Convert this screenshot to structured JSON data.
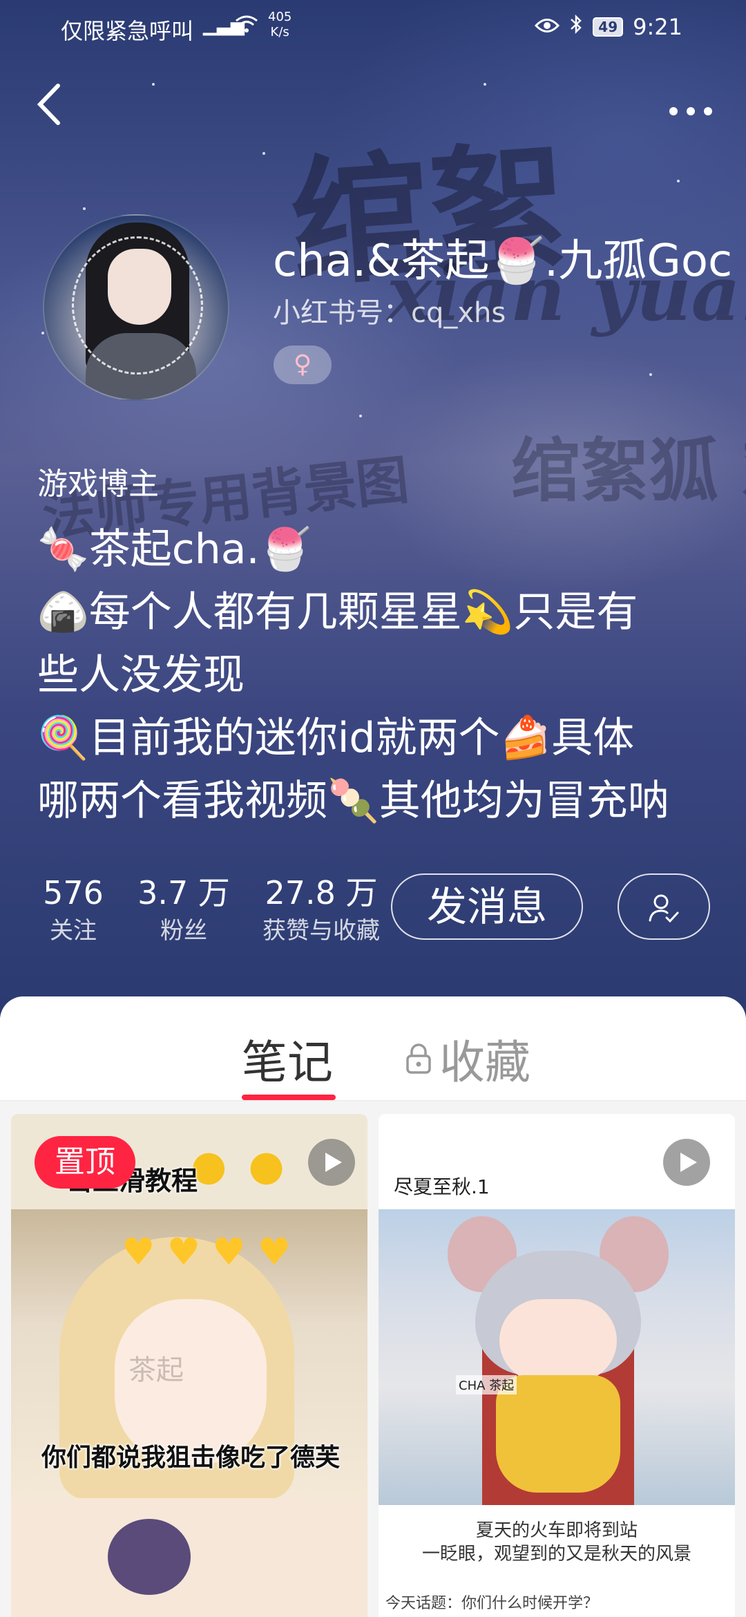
{
  "status_bar": {
    "carrier": "仅限紧急呼叫",
    "speed_value": "405",
    "speed_unit": "K/s",
    "battery": "49",
    "time": "9:21"
  },
  "profile": {
    "username": "cha.&茶起🍧.九孤Goc",
    "id_text": "小红书号：cq_xhs",
    "gender_symbol": "♀",
    "tag": "游戏博主",
    "bio_lines": [
      "🍬茶起cha.🍧",
      "🍙每个人都有几颗星星💫只是有",
      "些人没发现",
      "🍭目前我的迷你id就两个🍰具体",
      "哪两个看我视频🍡其他均为冒充呐"
    ]
  },
  "background_text": {
    "line1": "绾絮",
    "line2": "xian yuan",
    "line3": "法师专用背景图",
    "line4": "绾絮狐 欢迎你"
  },
  "stats": {
    "follow": {
      "num": "576",
      "label": "关注"
    },
    "fans": {
      "num": "3.7 万",
      "label": "粉丝"
    },
    "likes": {
      "num": "27.8 万",
      "label": "获赞与收藏"
    }
  },
  "actions": {
    "message": "发消息"
  },
  "tabs": {
    "notes": "笔记",
    "favorites": "收藏"
  },
  "cards": {
    "left": {
      "pinned": "置顶",
      "top_caption": "击丝滑教程",
      "watermark": "茶起",
      "caption": "你们都说我狙击像吃了德芙"
    },
    "right": {
      "title": "尽夏至秋.1",
      "image_tag": "CHA 茶起",
      "caption_line1": "夏天的火车即将到站",
      "caption_line2": "一眨眼，观望到的又是秋天的风景",
      "topic": "今天话题：你们什么时候开学？"
    }
  },
  "colors": {
    "accent": "#ff2442",
    "hero_bg": "#3b4680"
  }
}
